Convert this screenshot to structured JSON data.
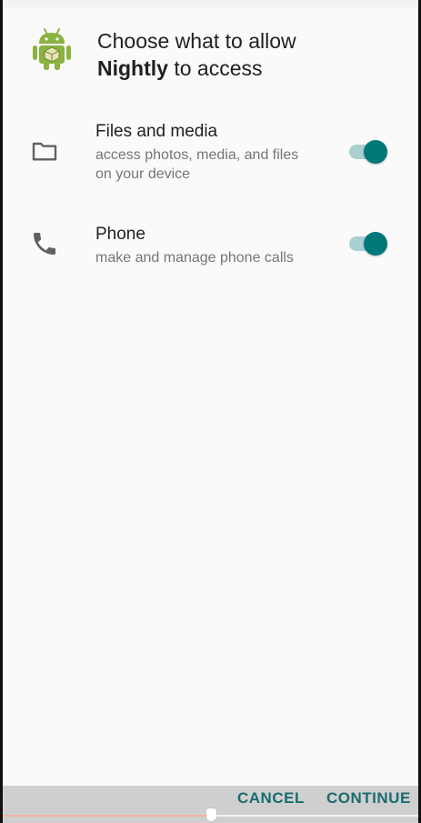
{
  "dialog": {
    "title_prefix": "Choose what to allow",
    "app_name": "Nightly",
    "title_suffix": "to access",
    "app_icon": "android-robot-icon"
  },
  "permissions": [
    {
      "title": "Files and media",
      "description": "access photos, media, and files on your device",
      "icon": "folder-icon",
      "enabled": true
    },
    {
      "title": "Phone",
      "description": "make and manage phone calls",
      "icon": "phone-icon",
      "enabled": true
    }
  ],
  "actions": {
    "cancel_label": "CANCEL",
    "continue_label": "CONTINUE"
  },
  "colors": {
    "accent": "#00787a",
    "accent_track": "#a9cfd0",
    "button_text": "#1a6c6e",
    "background": "#fafafa"
  },
  "seekbar": {
    "progress": 0.5
  }
}
